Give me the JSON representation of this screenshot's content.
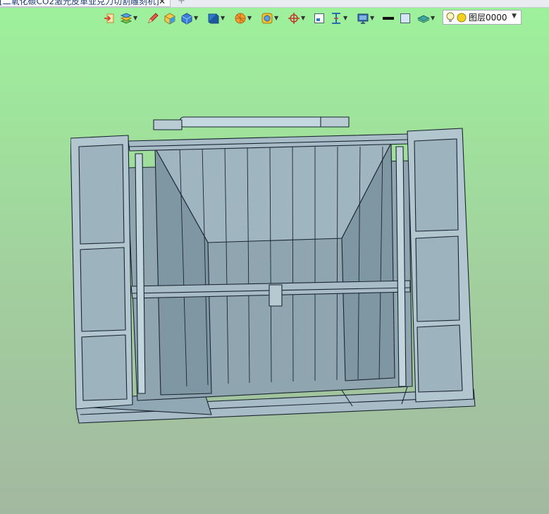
{
  "tab": {
    "title": "[二氧化碳CO2激光皮革亚克力切割雕刻机]",
    "close": "✕",
    "add": "+"
  },
  "toolbar": {
    "icons": [
      "exit-sketch-icon",
      "layers-stack-icon",
      "pencil-icon",
      "box-yellow-icon",
      "cube-blue-icon",
      "solid-display-icon",
      "orange-sphere-icon",
      "shading-icon",
      "pivot-icon",
      "frame-icon",
      "dimension-icon",
      "screen-icon",
      "black-line-icon",
      "color-swatch-icon",
      "plane-icon",
      "lightbulb-icon",
      "yellow-circle-icon"
    ]
  },
  "layer": {
    "value": "图层0000"
  }
}
